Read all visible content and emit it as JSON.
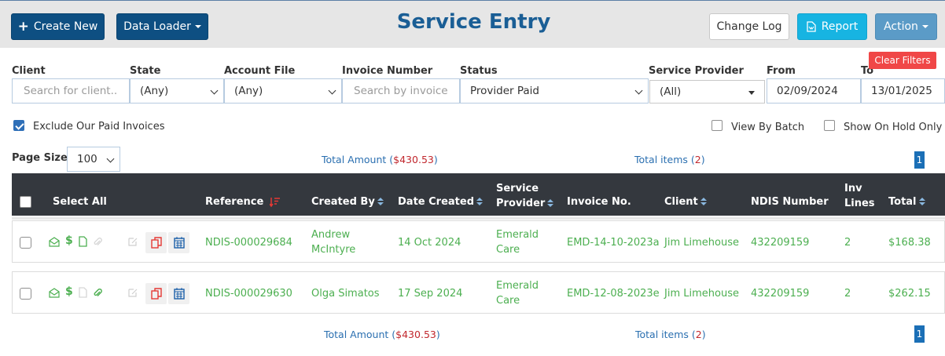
{
  "header": {
    "create_new": "Create New",
    "data_loader": "Data Loader",
    "title": "Service Entry",
    "change_log": "Change Log",
    "report": "Report",
    "action": "Action"
  },
  "filters": {
    "client": {
      "label": "Client",
      "placeholder": "Search for client..."
    },
    "state": {
      "label": "State",
      "value": "(Any)"
    },
    "account_file": {
      "label": "Account File",
      "value": "(Any)"
    },
    "invoice_number": {
      "label": "Invoice Number",
      "placeholder": "Search by invoice n"
    },
    "status": {
      "label": "Status",
      "value": "Provider Paid"
    },
    "service_provider": {
      "label": "Service Provider",
      "value": "(All)"
    },
    "from": {
      "label": "From",
      "value": "02/09/2024"
    },
    "to": {
      "label": "To",
      "value": "13/01/2025"
    },
    "clear": "Clear Filters"
  },
  "options": {
    "exclude_paid": "Exclude Our Paid Invoices",
    "view_by_batch": "View By Batch",
    "show_on_hold": "Show On Hold Only"
  },
  "paging": {
    "page_size_label": "Page Size:",
    "page_size": "100",
    "total_amount_label": "Total Amount",
    "total_amount_value": "$430.53",
    "total_items_label": "Total items",
    "total_items_value": "2",
    "page": "1"
  },
  "table": {
    "columns": {
      "select_all": "Select All",
      "reference": "Reference",
      "created_by": "Created By",
      "date_created": "Date Created",
      "service_provider_1": "Service",
      "service_provider_2": "Provider",
      "invoice_no": "Invoice No.",
      "client": "Client",
      "ndis_number": "NDIS Number",
      "inv_lines_1": "Inv",
      "inv_lines_2": "Lines",
      "total": "Total"
    },
    "rows": [
      {
        "reference": "NDIS-000029684",
        "created_by_1": "Andrew",
        "created_by_2": "McIntyre",
        "date_created": "14 Oct 2024",
        "provider_1": "Emerald",
        "provider_2": "Care",
        "invoice_no": "EMD-14-10-2023a",
        "client": "Jim Limehouse",
        "ndis_number": "432209159",
        "inv_lines": "2",
        "total": "$168.38"
      },
      {
        "reference": "NDIS-000029630",
        "created_by_1": "Olga Simatos",
        "created_by_2": "",
        "date_created": "17 Sep 2024",
        "provider_1": "Emerald",
        "provider_2": "Care",
        "invoice_no": "EMD-12-08-2023e",
        "client": "Jim Limehouse",
        "ndis_number": "432209159",
        "inv_lines": "2",
        "total": "$262.15"
      }
    ]
  },
  "colors": {
    "navy": "#0e4f82",
    "title": "#1a5e95",
    "cyan": "#17b4e2",
    "steel": "#5b9bc7",
    "row_text": "#4caf50",
    "clear": "#f04747",
    "table_header": "#34383e"
  }
}
